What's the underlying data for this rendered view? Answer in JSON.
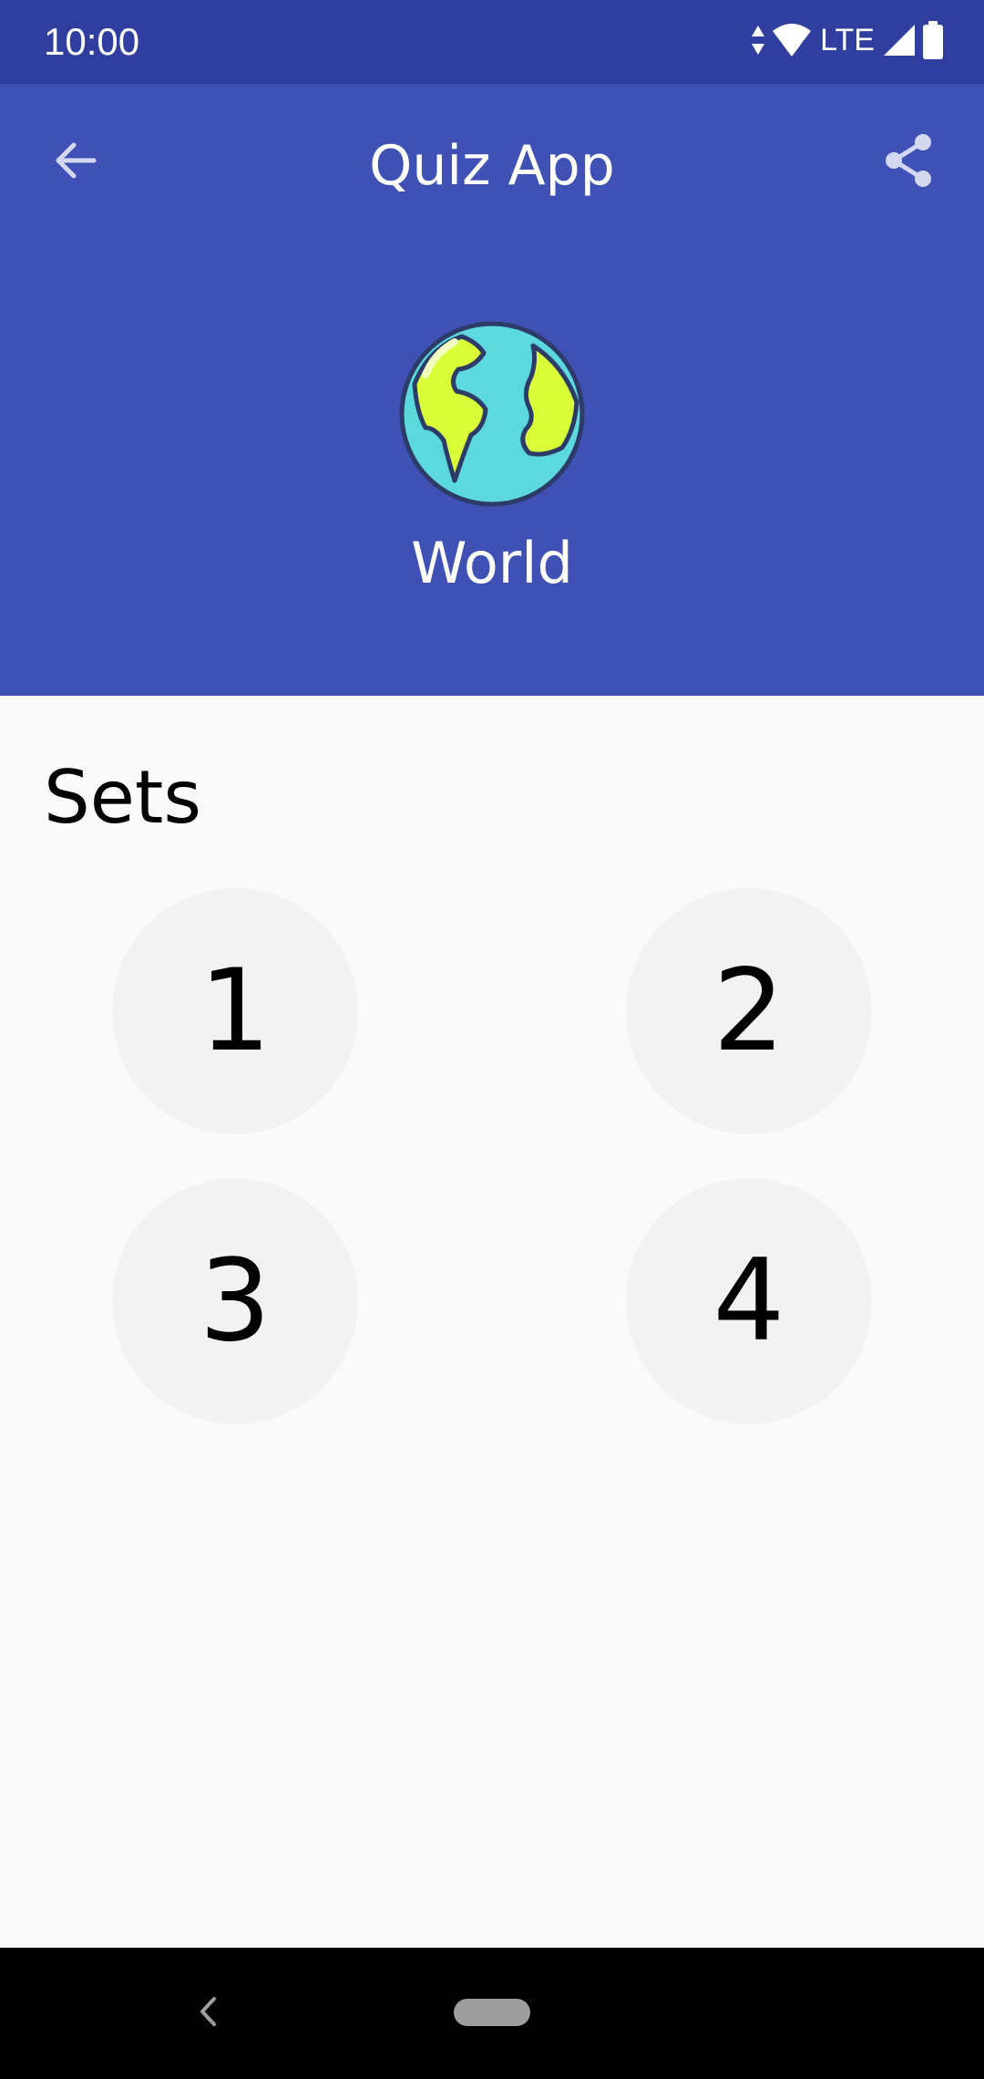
{
  "status_bar": {
    "time": "10:00",
    "network": "LTE",
    "icons": [
      "data-arrows-icon",
      "wifi-icon",
      "signal-icon",
      "battery-icon"
    ]
  },
  "app_bar": {
    "title": "Quiz App",
    "back_icon": "arrow-left-icon",
    "share_icon": "share-icon",
    "background": "#3f51b5",
    "status_background": "#303f9f"
  },
  "category": {
    "name": "World",
    "icon": "globe-icon"
  },
  "sets": {
    "heading": "Sets",
    "items": [
      {
        "label": "1"
      },
      {
        "label": "2"
      },
      {
        "label": "3"
      },
      {
        "label": "4"
      }
    ]
  },
  "nav_bar": {
    "back_icon": "chevron-left-icon",
    "home_icon": "home-pill-icon"
  }
}
